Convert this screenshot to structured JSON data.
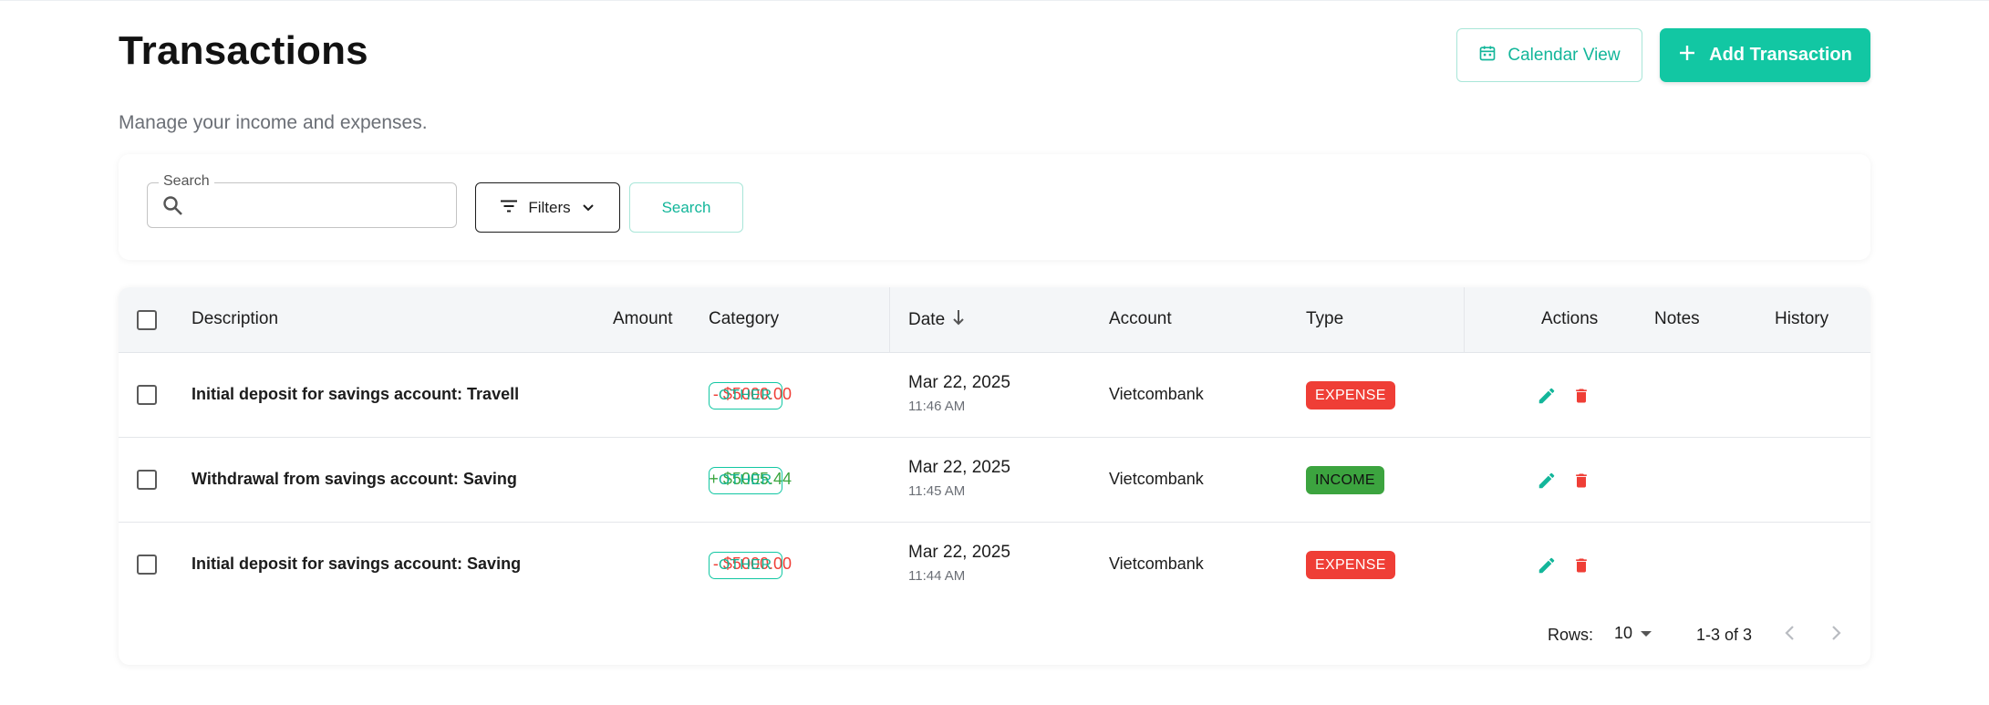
{
  "header": {
    "title": "Transactions",
    "subtitle": "Manage your income and expenses.",
    "calendar_label": "Calendar View",
    "add_label": "Add Transaction"
  },
  "search": {
    "legend": "Search",
    "placeholder": "",
    "filters_label": "Filters",
    "search_button": "Search"
  },
  "table": {
    "columns": {
      "description": "Description",
      "amount": "Amount",
      "category": "Category",
      "date": "Date",
      "account": "Account",
      "type": "Type",
      "actions": "Actions",
      "notes": "Notes",
      "history": "History"
    },
    "rows": [
      {
        "description": "Initial deposit for savings account: Travell",
        "amount": "- $5000.00",
        "category": "OTHER",
        "date": "Mar 22, 2025",
        "time": "11:46 AM",
        "account": "Vietcombank",
        "type": "EXPENSE"
      },
      {
        "description": "Withdrawal from savings account: Saving",
        "amount": "+ $5005.44",
        "category": "OTHER",
        "date": "Mar 22, 2025",
        "time": "11:45 AM",
        "account": "Vietcombank",
        "type": "INCOME"
      },
      {
        "description": "Initial deposit for savings account: Saving",
        "amount": "- $5000.00",
        "category": "OTHER",
        "date": "Mar 22, 2025",
        "time": "11:44 AM",
        "account": "Vietcombank",
        "type": "EXPENSE"
      }
    ]
  },
  "pagination": {
    "rows_label": "Rows:",
    "rows_value": "10",
    "range": "1-3 of 3"
  },
  "colors": {
    "accent": "#12c7a3",
    "expense": "#ef3e36",
    "income": "#3ca43f"
  },
  "icons": {
    "calendar": "calendar-icon",
    "add": "plus-icon",
    "search": "search-icon",
    "filter": "filter-icon",
    "sort": "arrow-down-icon",
    "edit": "pencil-icon",
    "delete": "trash-icon"
  }
}
